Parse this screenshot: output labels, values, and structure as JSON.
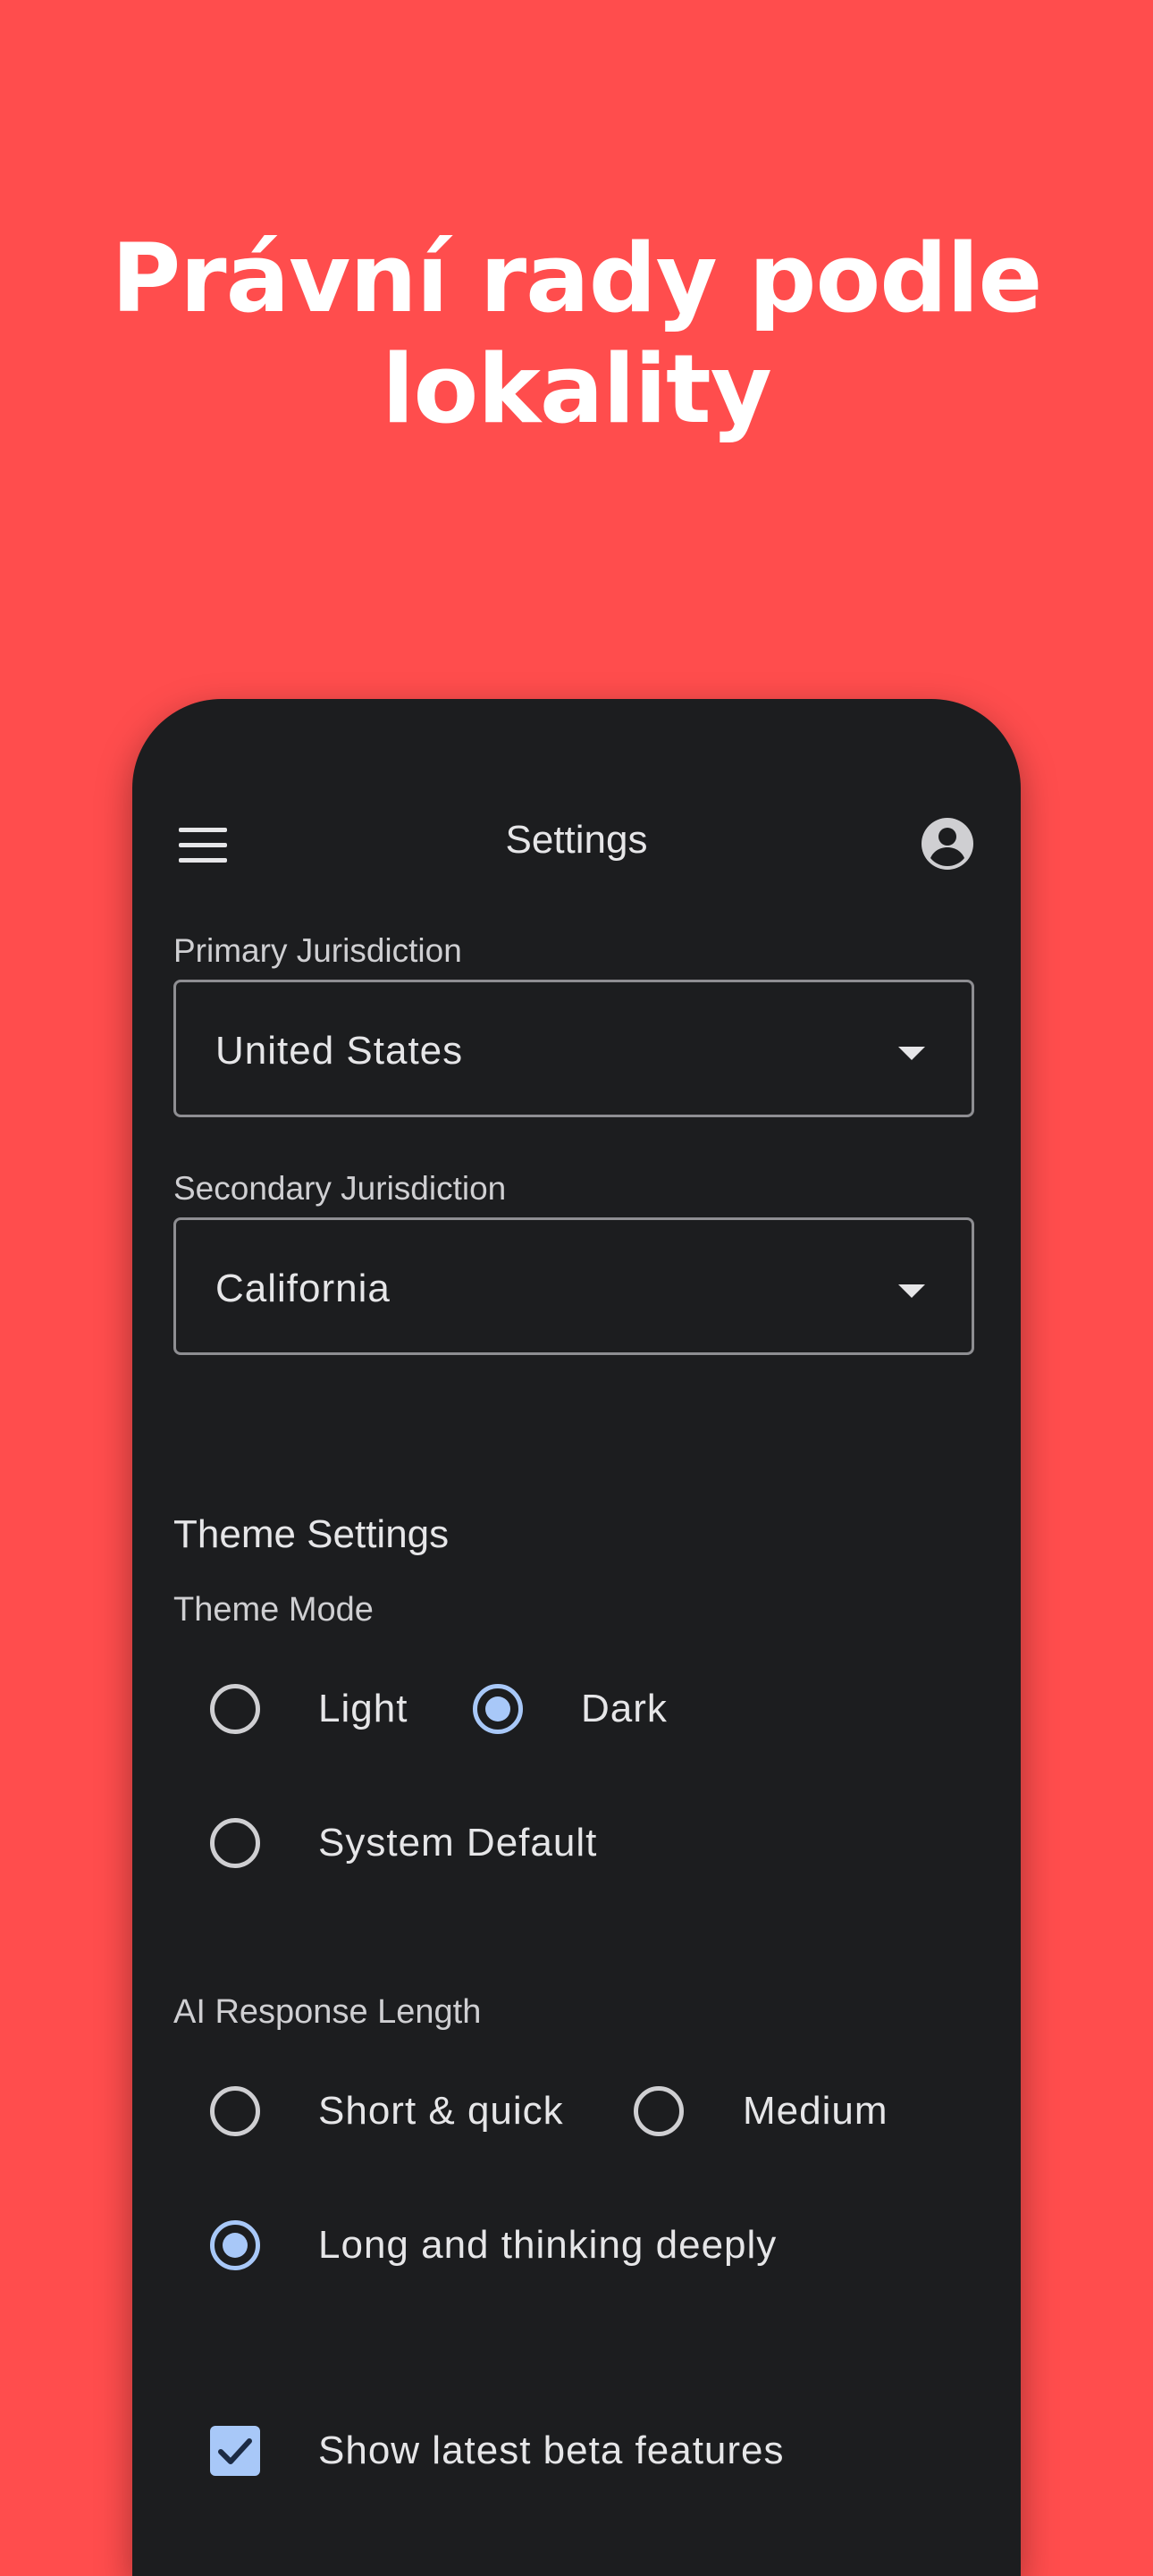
{
  "colors": {
    "background": "#ff4d4d",
    "headline_text": "#ffffff",
    "phone_surface": "#1c1d1f",
    "text_primary": "#e6e6e8",
    "text_secondary": "#cfcfd2",
    "outline": "#8e8e92",
    "accent": "#a8c8f8",
    "accent_dark": "#1c2b44"
  },
  "promo": {
    "headline_line1": "Právní rady podle",
    "headline_line2": "lokality"
  },
  "appbar": {
    "menu_icon": "menu-icon",
    "title": "Settings",
    "account_icon": "account-circle-icon"
  },
  "jurisdiction": {
    "primary_label": "Primary Jurisdiction",
    "primary_value": "United States",
    "secondary_label": "Secondary Jurisdiction",
    "secondary_value": "California",
    "dropdown_icon": "arrow-drop-down-icon"
  },
  "theme": {
    "section_title": "Theme Settings",
    "mode_label": "Theme Mode",
    "options": [
      {
        "label": "Light",
        "selected": false
      },
      {
        "label": "Dark",
        "selected": true
      },
      {
        "label": "System Default",
        "selected": false
      }
    ]
  },
  "ai_response": {
    "label": "AI Response Length",
    "options": [
      {
        "label": "Short & quick",
        "selected": false
      },
      {
        "label": "Medium",
        "selected": false
      },
      {
        "label": "Long and thinking deeply",
        "selected": true
      }
    ]
  },
  "beta": {
    "label": "Show latest beta features",
    "checked": true,
    "check_icon": "check-icon"
  }
}
